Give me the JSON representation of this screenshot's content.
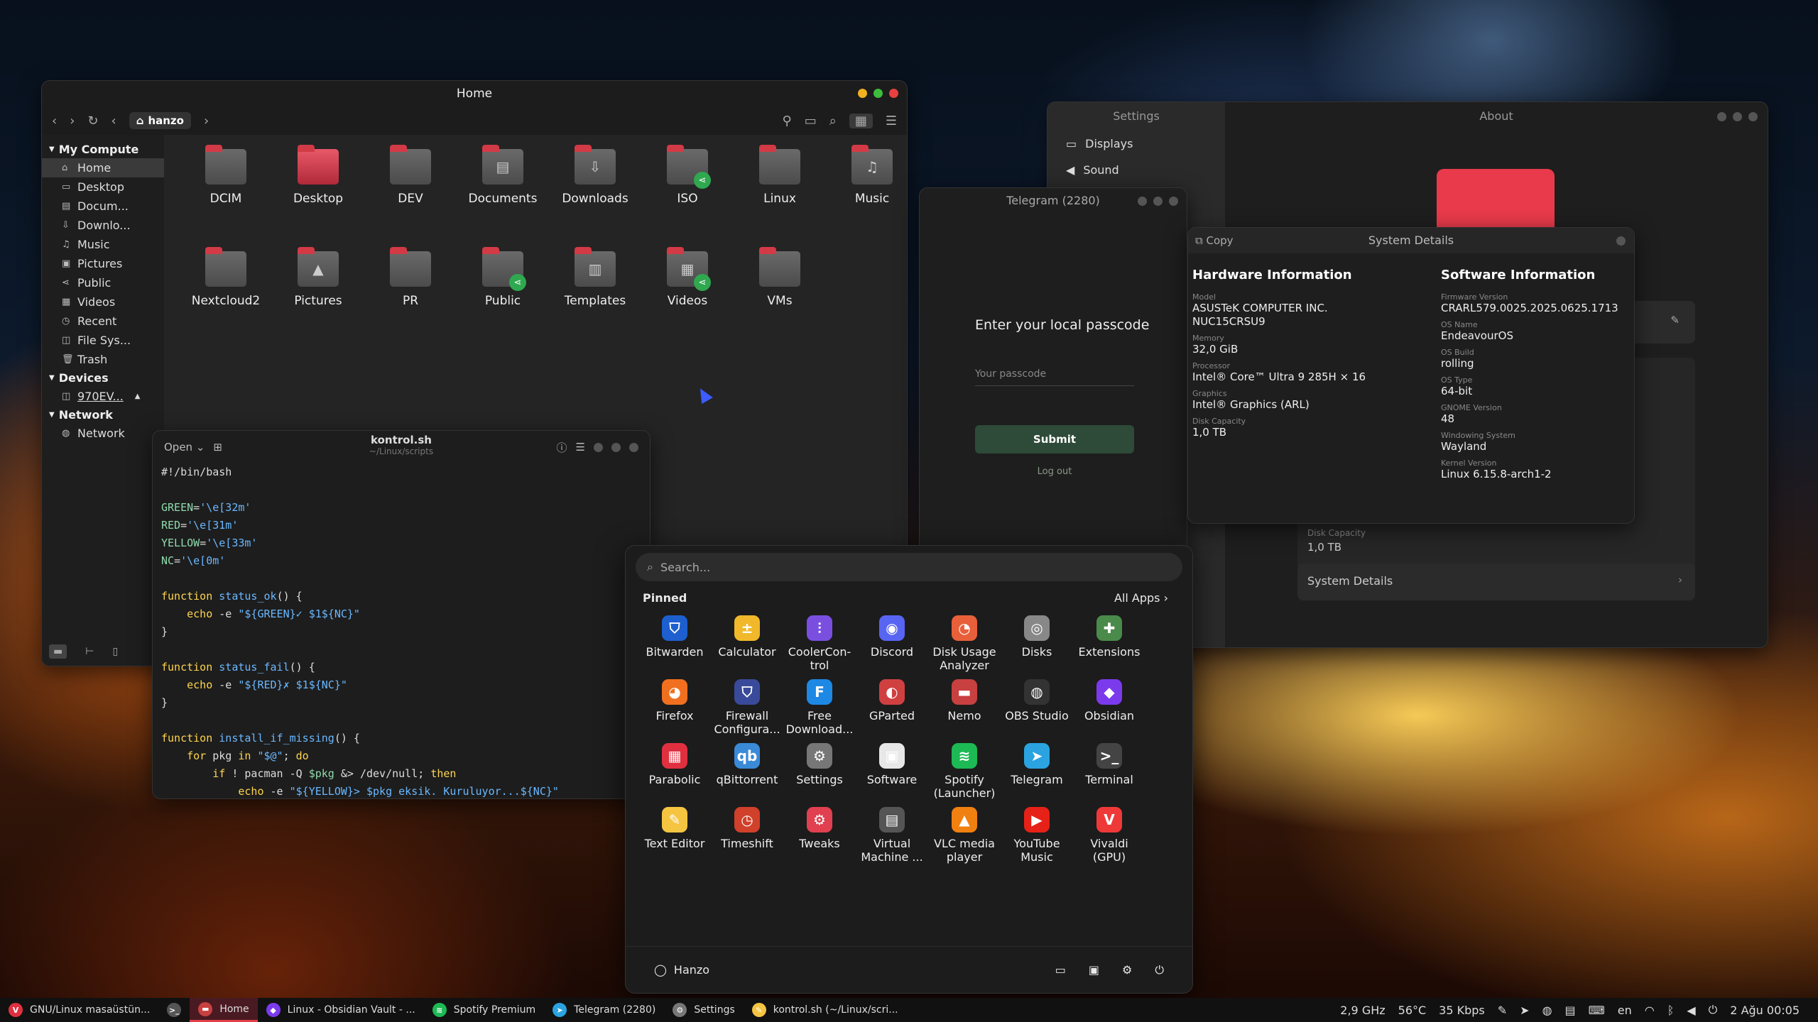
{
  "files": {
    "title": "Home",
    "breadcrumb": "hanzo",
    "sidebar": {
      "my_computer": "My Compute",
      "items": [
        {
          "label": "Home",
          "icon": "home-icon",
          "glyph": "⌂"
        },
        {
          "label": "Desktop",
          "icon": "desktop-icon",
          "glyph": "▭"
        },
        {
          "label": "Docum...",
          "icon": "document-icon",
          "glyph": "▤"
        },
        {
          "label": "Downlo...",
          "icon": "download-icon",
          "glyph": "⇩"
        },
        {
          "label": "Music",
          "icon": "music-icon",
          "glyph": "♫"
        },
        {
          "label": "Pictures",
          "icon": "picture-icon",
          "glyph": "▣"
        },
        {
          "label": "Public",
          "icon": "share-icon",
          "glyph": "⋖"
        },
        {
          "label": "Videos",
          "icon": "video-icon",
          "glyph": "▦"
        },
        {
          "label": "Recent",
          "icon": "clock-icon",
          "glyph": "◷"
        },
        {
          "label": "File Sys...",
          "icon": "drive-icon",
          "glyph": "◫"
        },
        {
          "label": "Trash",
          "icon": "trash-icon",
          "glyph": "🗑"
        }
      ],
      "devices_head": "Devices",
      "device": "970EV...",
      "network_head": "Network",
      "network": "Network"
    },
    "folders": [
      {
        "label": "DCIM",
        "sym": ""
      },
      {
        "label": "Desktop",
        "sym": "",
        "pink": true
      },
      {
        "label": "DEV",
        "sym": ""
      },
      {
        "label": "Documents",
        "sym": "▤"
      },
      {
        "label": "Downloads",
        "sym": "⇩"
      },
      {
        "label": "ISO",
        "sym": "",
        "share": true
      },
      {
        "label": "Linux",
        "sym": ""
      },
      {
        "label": "Music",
        "sym": "♫"
      },
      {
        "label": "Nextcloud2",
        "sym": ""
      },
      {
        "label": "Pictures",
        "sym": "▲"
      },
      {
        "label": "PR",
        "sym": ""
      },
      {
        "label": "Public",
        "sym": "",
        "share": true
      },
      {
        "label": "Templates",
        "sym": "▥"
      },
      {
        "label": "Videos",
        "sym": "▦",
        "share": true
      },
      {
        "label": "VMs",
        "sym": ""
      }
    ]
  },
  "settings": {
    "title": "Settings",
    "items": [
      "Displays",
      "Sound"
    ],
    "about_title": "About",
    "disk_label": "Disk Capacity",
    "disk_value": "1,0 TB",
    "system_details": "System Details"
  },
  "telegram": {
    "title": "Telegram (2280)",
    "prompt": "Enter your local passcode",
    "placeholder": "Your passcode",
    "submit": "Submit",
    "logout": "Log out"
  },
  "sysdet": {
    "copy": "Copy",
    "title": "System Details",
    "hardware_head": "Hardware Information",
    "software_head": "Software Information",
    "hardware": [
      {
        "k": "Model",
        "v": "ASUSTeK COMPUTER INC. NUC15CRSU9"
      },
      {
        "k": "Memory",
        "v": "32,0 GiB"
      },
      {
        "k": "Processor",
        "v": "Intel® Core™ Ultra 9 285H × 16"
      },
      {
        "k": "Graphics",
        "v": "Intel® Graphics (ARL)"
      },
      {
        "k": "Disk Capacity",
        "v": "1,0 TB"
      }
    ],
    "software": [
      {
        "k": "Firmware Version",
        "v": "CRARL579.0025.2025.0625.1713"
      },
      {
        "k": "OS Name",
        "v": "EndeavourOS"
      },
      {
        "k": "OS Build",
        "v": "rolling"
      },
      {
        "k": "OS Type",
        "v": "64-bit"
      },
      {
        "k": "GNOME Version",
        "v": "48"
      },
      {
        "k": "Windowing System",
        "v": "Wayland"
      },
      {
        "k": "Kernel Version",
        "v": "Linux 6.15.8-arch1-2"
      }
    ]
  },
  "editor": {
    "open": "Open",
    "filename": "kontrol.sh",
    "path": "~/Linux/scripts"
  },
  "appmenu": {
    "search_placeholder": "Search...",
    "pinned": "Pinned",
    "all_apps": "All Apps",
    "user": "Hanzo",
    "apps": [
      {
        "label": "Bitwarden",
        "color": "#1d5fcf",
        "g": "⛉"
      },
      {
        "label": "Calculator",
        "color": "#f0b82a",
        "g": "±"
      },
      {
        "label": "CoolerCon-trol",
        "color": "#7a4fe0",
        "g": "⫶"
      },
      {
        "label": "Discord",
        "color": "#5865f2",
        "g": "◉"
      },
      {
        "label": "Disk Usage Analyzer",
        "color": "#e8603a",
        "g": "◔"
      },
      {
        "label": "Disks",
        "color": "#888888",
        "g": "◎"
      },
      {
        "label": "Extensions",
        "color": "#4a8a4a",
        "g": "✚"
      },
      {
        "label": "Firefox",
        "color": "#f07020",
        "g": "◕"
      },
      {
        "label": "Firewall Configura...",
        "color": "#3a4a9a",
        "g": "⛉"
      },
      {
        "label": "Free Download...",
        "color": "#1e88e5",
        "g": "F"
      },
      {
        "label": "GParted",
        "color": "#d04040",
        "g": "◐"
      },
      {
        "label": "Nemo",
        "color": "#c84040",
        "g": "▬"
      },
      {
        "label": "OBS Studio",
        "color": "#333333",
        "g": "◍"
      },
      {
        "label": "Obsidian",
        "color": "#7c3aed",
        "g": "◆"
      },
      {
        "label": "Parabolic",
        "color": "#e03040",
        "g": "▦"
      },
      {
        "label": "qBittorrent",
        "color": "#3a8ad8",
        "g": "qb"
      },
      {
        "label": "Settings",
        "color": "#777777",
        "g": "⚙"
      },
      {
        "label": "Software",
        "color": "#e8e8e8",
        "g": "▣"
      },
      {
        "label": "Spotify (Launcher)",
        "color": "#1db954",
        "g": "≋"
      },
      {
        "label": "Telegram",
        "color": "#2aa3e0",
        "g": "➤"
      },
      {
        "label": "Terminal",
        "color": "#444444",
        "g": ">_"
      },
      {
        "label": "Text Editor",
        "color": "#f5c542",
        "g": "✎"
      },
      {
        "label": "Timeshift",
        "color": "#d0402a",
        "g": "◷"
      },
      {
        "label": "Tweaks",
        "color": "#e04050",
        "g": "⚙"
      },
      {
        "label": "Virtual Machine ...",
        "color": "#555555",
        "g": "▤"
      },
      {
        "label": "VLC media player",
        "color": "#f08010",
        "g": "▲"
      },
      {
        "label": "YouTube Music",
        "color": "#e62117",
        "g": "▶"
      },
      {
        "label": "Vivaldi (GPU)",
        "color": "#ef3939",
        "g": "V"
      }
    ]
  },
  "taskbar": {
    "tasks": [
      {
        "label": "GNU/Linux masaüstün...",
        "color": "#e03040",
        "g": "V"
      },
      {
        "label": "",
        "color": "#555555",
        "g": ">_"
      },
      {
        "label": "Home",
        "color": "#c84040",
        "g": "▬",
        "active": true
      },
      {
        "label": "Linux - Obsidian Vault - ...",
        "color": "#7c3aed",
        "g": "◆"
      },
      {
        "label": "Spotify Premium",
        "color": "#1db954",
        "g": "≋"
      },
      {
        "label": "Telegram (2280)",
        "color": "#2aa3e0",
        "g": "➤"
      },
      {
        "label": "Settings",
        "color": "#777777",
        "g": "⚙"
      },
      {
        "label": "kontrol.sh (~/Linux/scri...",
        "color": "#f5c542",
        "g": "✎"
      }
    ],
    "cpu": "2,9 GHz",
    "temp": "56°C",
    "net": "35 Kbps",
    "lang": "en",
    "clock": "2 Ağu 00:05"
  }
}
